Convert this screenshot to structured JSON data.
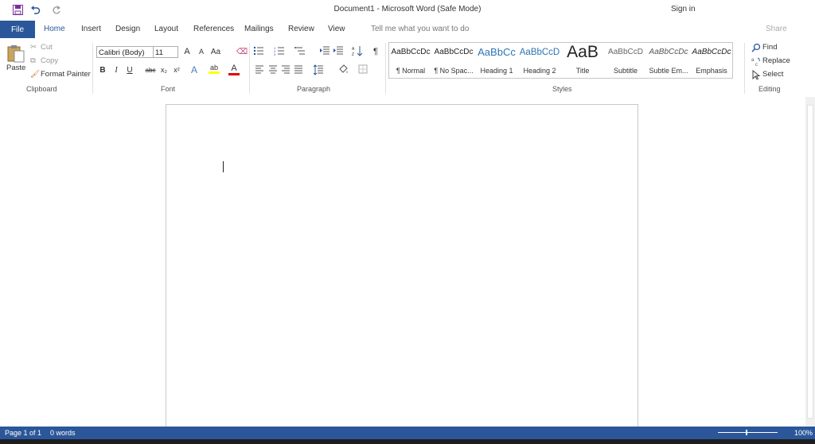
{
  "title": "Document1  -  Microsoft Word (Safe Mode)",
  "sign_in": "Sign in",
  "share": "Share",
  "tabs": {
    "file": "File",
    "items": [
      "Home",
      "Insert",
      "Design",
      "Layout",
      "References",
      "Mailings",
      "Review",
      "View"
    ]
  },
  "tell_me": "Tell me what you want to do",
  "clipboard": {
    "paste": "Paste",
    "cut": "Cut",
    "copy": "Copy",
    "format_painter": "Format Painter",
    "label": "Clipboard"
  },
  "font": {
    "name": "Calibri (Body)",
    "size": "11",
    "label": "Font",
    "grow": "A",
    "shrink": "A",
    "case": "Aa",
    "bold": "B",
    "italic": "I",
    "underline": "U",
    "strike": "abc",
    "subscript": "x₂",
    "superscript": "x²",
    "effects": "A",
    "highlight": "ab",
    "color": "A"
  },
  "paragraph": {
    "label": "Paragraph",
    "pilcrow": "¶"
  },
  "styles": {
    "label": "Styles",
    "items": [
      {
        "sample": "AaBbCcDc",
        "name": "¶ Normal"
      },
      {
        "sample": "AaBbCcDc",
        "name": "¶ No Spac..."
      },
      {
        "sample": "AaBbCc",
        "name": "Heading 1"
      },
      {
        "sample": "AaBbCcD",
        "name": "Heading 2"
      },
      {
        "sample": "AaB",
        "name": "Title"
      },
      {
        "sample": "AaBbCcD",
        "name": "Subtitle"
      },
      {
        "sample": "AaBbCcDc",
        "name": "Subtle Em..."
      },
      {
        "sample": "AaBbCcDc",
        "name": "Emphasis"
      }
    ]
  },
  "editing": {
    "label": "Editing",
    "find": "Find",
    "replace": "Replace",
    "select": "Select"
  },
  "status": {
    "page": "Page 1 of 1",
    "words": "0 words",
    "zoom": "100%"
  },
  "colors": {
    "brand": "#2b579a",
    "font_color_bar": "#e00000",
    "highlight_bar": "#ffff00"
  }
}
